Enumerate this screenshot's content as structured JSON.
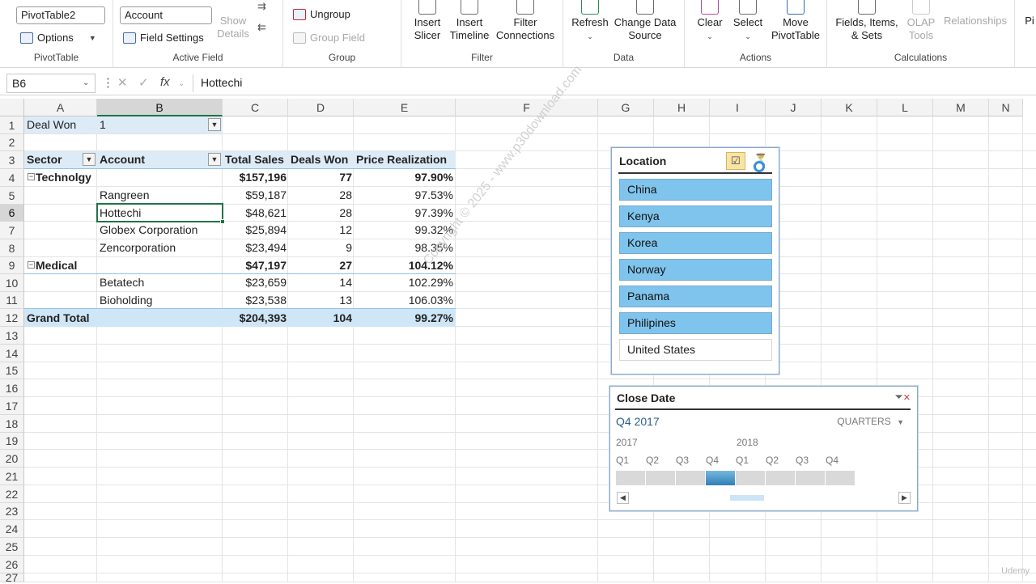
{
  "ribbon": {
    "pivottable_name": "PivotTable2",
    "options_label": "Options",
    "pivottable_group": "PivotTable",
    "active_field_value": "Account",
    "field_settings_label": "Field Settings",
    "show_details_label": "Show Details",
    "active_field_group": "Active Field",
    "ungroup_label": "Ungroup",
    "group_field_label": "Group Field",
    "group_group": "Group",
    "insert_slicer_label": "Insert Slicer",
    "insert_timeline_label": "Insert Timeline",
    "filter_connections_label": "Filter Connections",
    "filter_group": "Filter",
    "refresh_label": "Refresh",
    "change_data_source_label": "Change Data Source",
    "data_group": "Data",
    "clear_label": "Clear",
    "select_label": "Select",
    "move_pivottable_label": "Move PivotTable",
    "actions_group": "Actions",
    "fields_items_sets_label": "Fields, Items, & Sets",
    "olap_tools_label": "OLAP Tools",
    "relationships_label": "Relationships",
    "calculations_group": "Calculations",
    "overflow_label": "Pi"
  },
  "formula_bar": {
    "name_box": "B6",
    "fx_symbol": "fx",
    "content": "Hottechi"
  },
  "columns": [
    "A",
    "B",
    "C",
    "D",
    "E",
    "F",
    "G",
    "H",
    "I",
    "J",
    "K",
    "L",
    "M",
    "N"
  ],
  "rows": [
    "1",
    "2",
    "3",
    "4",
    "5",
    "6",
    "7",
    "8",
    "9",
    "10",
    "11",
    "12",
    "13",
    "14",
    "15",
    "16",
    "17",
    "18",
    "19",
    "20",
    "21",
    "22",
    "23",
    "24",
    "25",
    "26",
    "27"
  ],
  "pivot": {
    "filter_label": "Deal Won",
    "filter_value": "1",
    "headers": [
      "Sector",
      "Account",
      "Total Sales",
      "Deals Won",
      "Price Realization"
    ],
    "sectors": [
      {
        "name": "Technolgy",
        "total_sales": "$157,196",
        "deals_won": "77",
        "price_realization": "97.90%",
        "accounts": [
          {
            "name": "Rangreen",
            "total_sales": "$59,187",
            "deals_won": "28",
            "price_realization": "97.53%"
          },
          {
            "name": "Hottechi",
            "total_sales": "$48,621",
            "deals_won": "28",
            "price_realization": "97.39%"
          },
          {
            "name": "Globex Corporation",
            "total_sales": "$25,894",
            "deals_won": "12",
            "price_realization": "99.32%"
          },
          {
            "name": "Zencorporation",
            "total_sales": "$23,494",
            "deals_won": "9",
            "price_realization": "98.35%"
          }
        ]
      },
      {
        "name": "Medical",
        "total_sales": "$47,197",
        "deals_won": "27",
        "price_realization": "104.12%",
        "accounts": [
          {
            "name": "Betatech",
            "total_sales": "$23,659",
            "deals_won": "14",
            "price_realization": "102.29%"
          },
          {
            "name": "Bioholding",
            "total_sales": "$23,538",
            "deals_won": "13",
            "price_realization": "106.03%"
          }
        ]
      }
    ],
    "grand_total": {
      "label": "Grand Total",
      "total_sales": "$204,393",
      "deals_won": "104",
      "price_realization": "99.27%"
    }
  },
  "slicer_location": {
    "title": "Location",
    "items": [
      {
        "label": "China",
        "selected": true
      },
      {
        "label": "Kenya",
        "selected": true
      },
      {
        "label": "Korea",
        "selected": true
      },
      {
        "label": "Norway",
        "selected": true
      },
      {
        "label": "Panama",
        "selected": true
      },
      {
        "label": "Philipines",
        "selected": true
      },
      {
        "label": "United States",
        "selected": false
      }
    ]
  },
  "timeline": {
    "title": "Close Date",
    "selection": "Q4 2017",
    "level": "QUARTERS",
    "years": [
      "2017",
      "2018"
    ],
    "quarters": [
      "Q1",
      "Q2",
      "Q3",
      "Q4",
      "Q1",
      "Q2",
      "Q3",
      "Q4"
    ],
    "selected_index": 3
  },
  "watermark": "Copyright © 2025 - www.p30download.com",
  "corner_mark": "Udemy",
  "colors": {
    "accent_green": "#217346",
    "slicer_selected": "#7fc4ec",
    "pivot_header_band": "#ddebf7",
    "timeline_selected": "#2f7fb6"
  }
}
